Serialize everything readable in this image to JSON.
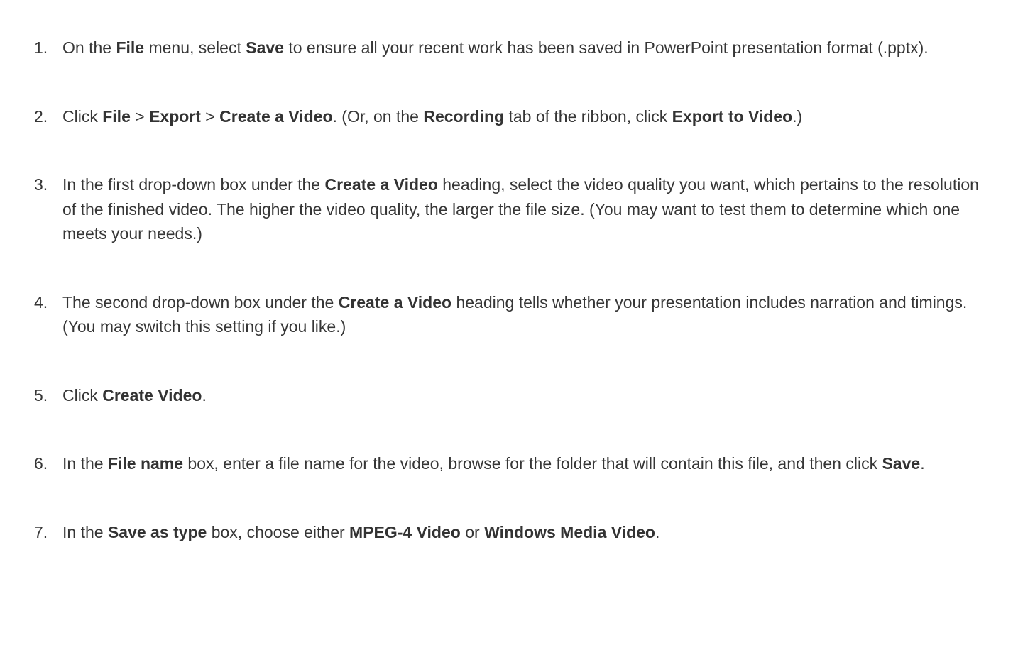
{
  "steps": [
    {
      "segments": [
        {
          "text": "On the ",
          "bold": false
        },
        {
          "text": "File",
          "bold": true
        },
        {
          "text": " menu, select ",
          "bold": false
        },
        {
          "text": "Save",
          "bold": true
        },
        {
          "text": " to ensure all your recent work has been saved in PowerPoint presentation format (.pptx).",
          "bold": false
        }
      ]
    },
    {
      "segments": [
        {
          "text": "Click ",
          "bold": false
        },
        {
          "text": "File",
          "bold": true
        },
        {
          "text": " > ",
          "bold": false
        },
        {
          "text": "Export",
          "bold": true
        },
        {
          "text": " > ",
          "bold": false
        },
        {
          "text": "Create a Video",
          "bold": true
        },
        {
          "text": ". (Or, on the ",
          "bold": false
        },
        {
          "text": "Recording",
          "bold": true
        },
        {
          "text": " tab of the ribbon, click ",
          "bold": false
        },
        {
          "text": "Export to Video",
          "bold": true
        },
        {
          "text": ".)",
          "bold": false
        }
      ]
    },
    {
      "segments": [
        {
          "text": "In the first drop-down box under the ",
          "bold": false
        },
        {
          "text": "Create a Video",
          "bold": true
        },
        {
          "text": " heading, select the video quality you want, which pertains to the resolution of the finished video. The higher the video quality, the larger the file size. (You may want to test them to determine which one meets your needs.)",
          "bold": false
        }
      ]
    },
    {
      "segments": [
        {
          "text": "The second drop-down box under the ",
          "bold": false
        },
        {
          "text": "Create a Video",
          "bold": true
        },
        {
          "text": " heading tells whether your presentation includes narration and timings. (You may switch this setting if you like.)",
          "bold": false
        }
      ]
    },
    {
      "segments": [
        {
          "text": "Click ",
          "bold": false
        },
        {
          "text": "Create Video",
          "bold": true
        },
        {
          "text": ".",
          "bold": false
        }
      ]
    },
    {
      "segments": [
        {
          "text": "In the ",
          "bold": false
        },
        {
          "text": "File name",
          "bold": true
        },
        {
          "text": " box, enter a file name for the video, browse for the folder that will contain this file, and then click ",
          "bold": false
        },
        {
          "text": "Save",
          "bold": true
        },
        {
          "text": ".",
          "bold": false
        }
      ]
    },
    {
      "segments": [
        {
          "text": "In the ",
          "bold": false
        },
        {
          "text": "Save as type",
          "bold": true
        },
        {
          "text": " box, choose either ",
          "bold": false
        },
        {
          "text": "MPEG-4 Video",
          "bold": true
        },
        {
          "text": " or ",
          "bold": false
        },
        {
          "text": "Windows Media Video",
          "bold": true
        },
        {
          "text": ".",
          "bold": false
        }
      ]
    }
  ]
}
